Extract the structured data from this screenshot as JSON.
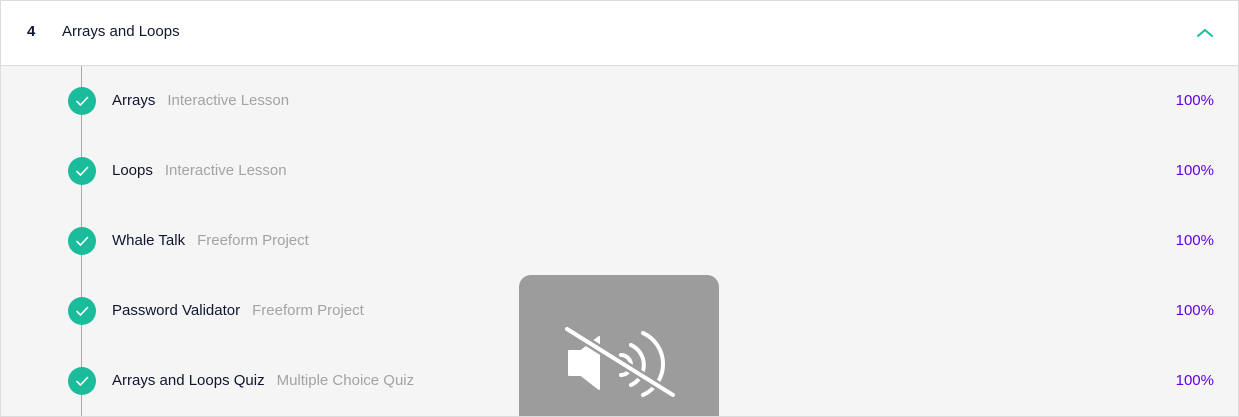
{
  "module": {
    "number": "4",
    "title": "Arrays and Loops",
    "expanded": true,
    "toggle_icon": "chevron-up-icon"
  },
  "colors": {
    "accent": "#1bbc9b",
    "progress": "#6400e4",
    "text": "#10162f",
    "muted_text": "#a3a3a3",
    "overlay": "#9c9c9c"
  },
  "items": [
    {
      "title": "Arrays",
      "type": "Interactive Lesson",
      "progress": "100%",
      "completed": true
    },
    {
      "title": "Loops",
      "type": "Interactive Lesson",
      "progress": "100%",
      "completed": true
    },
    {
      "title": "Whale Talk",
      "type": "Freeform Project",
      "progress": "100%",
      "completed": true
    },
    {
      "title": "Password Validator",
      "type": "Freeform Project",
      "progress": "100%",
      "completed": true
    },
    {
      "title": "Arrays and Loops Quiz",
      "type": "Multiple Choice Quiz",
      "progress": "100%",
      "completed": true
    }
  ],
  "overlay": {
    "icon": "muted-speaker-icon"
  }
}
